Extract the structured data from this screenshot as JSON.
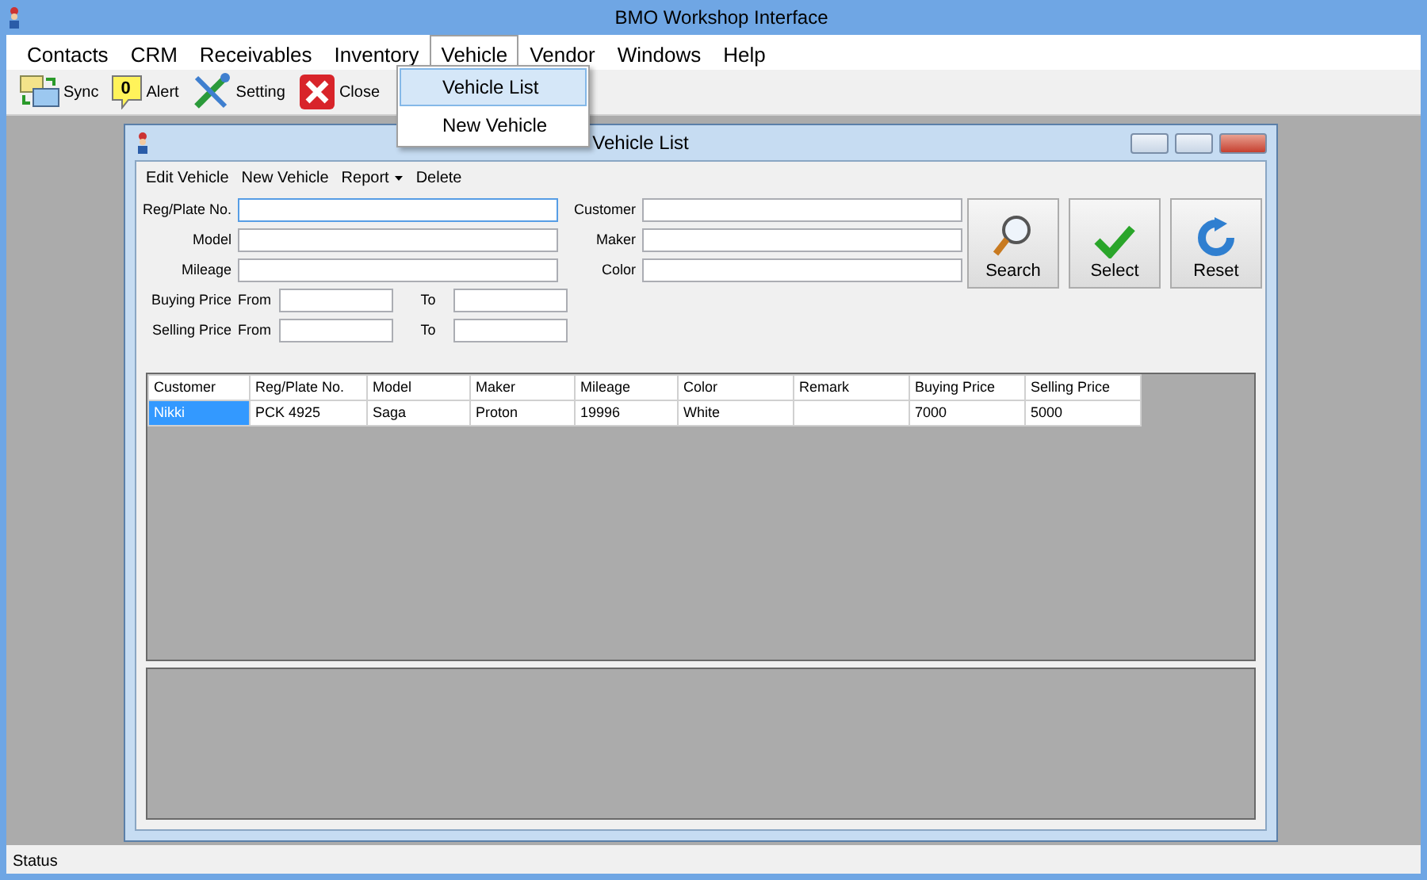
{
  "window": {
    "title": "BMO Workshop Interface"
  },
  "menu": [
    {
      "label": "Contacts",
      "selected": false
    },
    {
      "label": "CRM",
      "selected": false
    },
    {
      "label": "Receivables",
      "selected": false
    },
    {
      "label": "Inventory",
      "selected": false
    },
    {
      "label": "Vehicle",
      "selected": true
    },
    {
      "label": "Vendor",
      "selected": false
    },
    {
      "label": "Windows",
      "selected": false
    },
    {
      "label": "Help",
      "selected": false
    }
  ],
  "dropdown": [
    {
      "label": "Vehicle List",
      "selected": true
    },
    {
      "label": "New Vehicle",
      "selected": false
    }
  ],
  "toolbar": [
    {
      "kind": "sync",
      "label": "Sync"
    },
    {
      "kind": "alert",
      "label": "Alert",
      "badge": "0"
    },
    {
      "kind": "setting",
      "label": "Setting"
    },
    {
      "kind": "close",
      "label": "Close"
    }
  ],
  "child": {
    "title": "Vehicle List",
    "menu": [
      {
        "label": "Edit Vehicle",
        "dropdown": false
      },
      {
        "label": "New Vehicle",
        "dropdown": false
      },
      {
        "label": "Report",
        "dropdown": true
      },
      {
        "label": "Delete",
        "dropdown": false
      }
    ],
    "left_fields": [
      {
        "kind": "single",
        "label": "Reg/Plate No.",
        "focused": true
      },
      {
        "kind": "single",
        "label": "Model",
        "focused": false
      },
      {
        "kind": "single",
        "label": "Mileage",
        "focused": false
      },
      {
        "kind": "range",
        "label": "Buying Price",
        "from": "From",
        "to": "To"
      },
      {
        "kind": "range",
        "label": "Selling Price",
        "from": "From",
        "to": "To"
      }
    ],
    "right_fields": [
      {
        "label": "Customer"
      },
      {
        "label": "Maker"
      },
      {
        "label": "Color"
      }
    ],
    "buttons": [
      {
        "kind": "search",
        "label": "Search"
      },
      {
        "kind": "select",
        "label": "Select"
      },
      {
        "kind": "reset",
        "label": "Reset"
      }
    ],
    "table": {
      "columns": [
        "Customer",
        "Reg/Plate No.",
        "Model",
        "Maker",
        "Mileage",
        "Color",
        "Remark",
        "Buying Price",
        "Selling Price"
      ],
      "rows": [
        {
          "cells": [
            {
              "text": "Nikki",
              "selected": true
            },
            {
              "text": "PCK 4925",
              "selected": false
            },
            {
              "text": "Saga",
              "selected": false
            },
            {
              "text": "Proton",
              "selected": false
            },
            {
              "text": "19996",
              "selected": false
            },
            {
              "text": "White",
              "selected": false
            },
            {
              "selected": false
            },
            {
              "text": "7000",
              "selected": false
            },
            {
              "text": "5000",
              "selected": false
            }
          ]
        }
      ]
    }
  },
  "status_bar": "Status"
}
